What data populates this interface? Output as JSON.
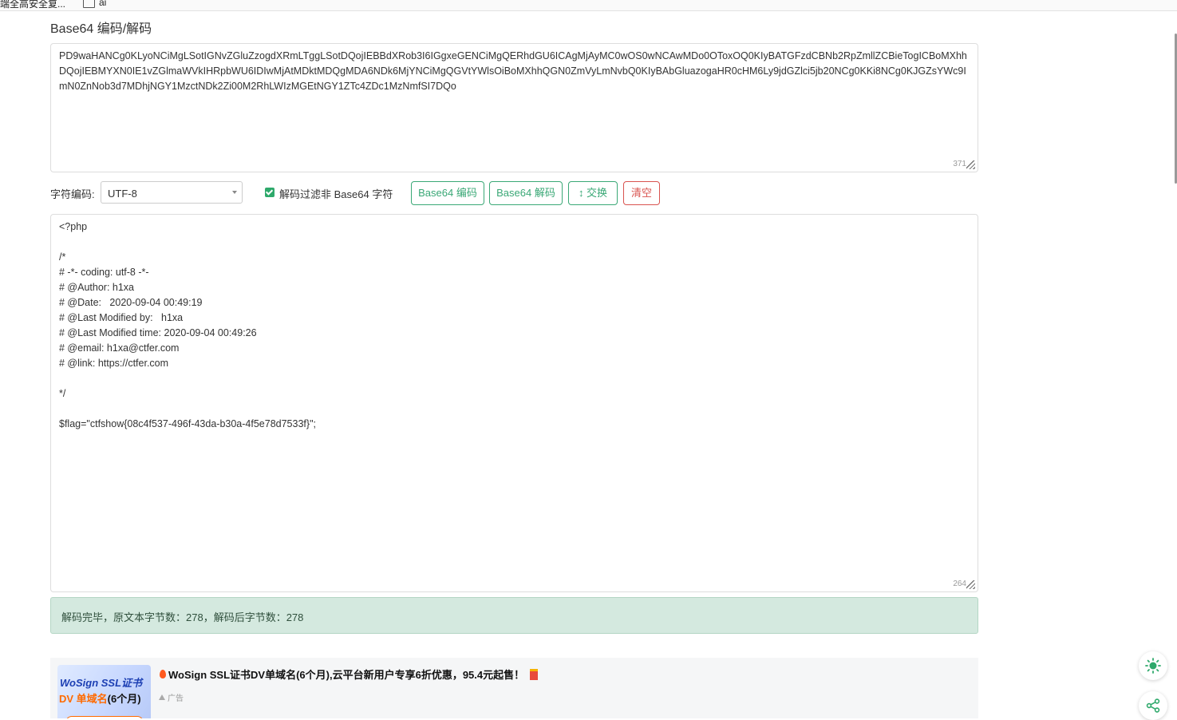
{
  "bookmarks": [
    "端全高安全复...",
    "ai"
  ],
  "page": {
    "title": "Base64 编码/解码"
  },
  "input": {
    "text": "PD9waHANCg0KLyoNCiMgLSotIGNvZGluZzogdXRmLTggLSotDQojIEBBdXRob3I6IGgxeGENCiMgQERhdGU6ICAgMjAyMC0wOS0wNCAwMDo0OToxOQ0KIyBATGFzdCBNb2RpZmllZCBieTogICBoMXhhDQojIEBMYXN0IE1vZGlmaWVkIHRpbWU6IDIwMjAtMDktMDQgMDA6NDk6MjYNCiMgQGVtYWlsOiBoMXhhQGN0ZmVyLmNvbQ0KIyBAbGluazogaHR0cHM6Ly9jdGZlci5jb20NCg0KKi8NCg0KJGZsYWc9ImN0ZnNob3d7MDhjNGY1MzctNDk2Zi00M2RhLWIzMGEtNGY1ZTc4ZDc1MzNmfSI7DQo",
    "counter": "371"
  },
  "controls": {
    "encoding_label": "字符编码:",
    "encoding_value": "UTF-8",
    "filter_label": "解码过滤非 Base64 字符",
    "encode_button": "Base64 编码",
    "decode_button": "Base64 解码",
    "swap_button": "↕ 交换",
    "clear_button": "清空"
  },
  "output": {
    "text": "<?php\n\n/*\n# -*- coding: utf-8 -*-\n# @Author: h1xa\n# @Date:   2020-09-04 00:49:19\n# @Last Modified by:   h1xa\n# @Last Modified time: 2020-09-04 00:49:26\n# @email: h1xa@ctfer.com\n# @link: https://ctfer.com\n\n*/\n\n$flag=\"ctfshow{08c4f537-496f-43da-b30a-4f5e78d7533f}\";",
    "counter": "264"
  },
  "result": {
    "message": "解码完毕，原文本字节数：278，解码后字节数：278"
  },
  "ad": {
    "image_line1": "WoSign SSL证书",
    "image_line2_orange": "DV 单域名",
    "image_line2_black": "(6个月)",
    "title": "WoSign SSL证书DV单域名(6个月),云平台新用户专享6折优惠，95.4元起售！",
    "tag": "广告"
  },
  "icons": {
    "theme": "sun-icon",
    "share": "share-icon",
    "accent": "#2ea96b"
  }
}
